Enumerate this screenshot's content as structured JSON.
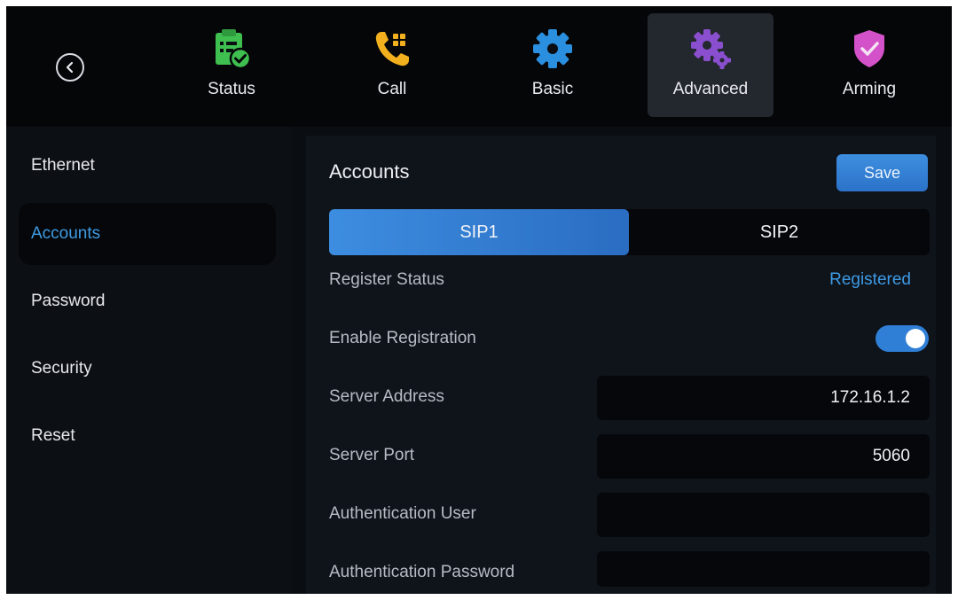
{
  "topnav": {
    "tabs": [
      {
        "label": "Status",
        "icon": "status-icon"
      },
      {
        "label": "Call",
        "icon": "call-icon"
      },
      {
        "label": "Basic",
        "icon": "basic-icon"
      },
      {
        "label": "Advanced",
        "icon": "advanced-icon",
        "active": true
      },
      {
        "label": "Arming",
        "icon": "arming-icon"
      }
    ],
    "back_icon": "back-icon"
  },
  "sidebar": {
    "items": [
      {
        "label": "Ethernet"
      },
      {
        "label": "Accounts",
        "active": true
      },
      {
        "label": "Password"
      },
      {
        "label": "Security"
      },
      {
        "label": "Reset"
      }
    ]
  },
  "main": {
    "title": "Accounts",
    "save_label": "Save",
    "segments": [
      "SIP1",
      "SIP2"
    ],
    "active_segment": "SIP1",
    "register_status_label": "Register Status",
    "register_status_value": "Registered",
    "enable_registration_label": "Enable Registration",
    "enable_registration_on": true,
    "server_address_label": "Server Address",
    "server_address_value": "172.16.1.2",
    "server_port_label": "Server Port",
    "server_port_value": "5060",
    "auth_user_label": "Authentication User",
    "auth_user_value": "",
    "auth_password_label": "Authentication Password",
    "auth_password_value": ""
  },
  "colors": {
    "accent": "#3c9be6",
    "background": "#0a0d12",
    "status_icon": "#3fbf4f",
    "call_icon": "#f2b01e",
    "basic_icon": "#2b8fe0",
    "advanced_icon": "#8a4fcf",
    "arming_icon": "#d452c9"
  }
}
